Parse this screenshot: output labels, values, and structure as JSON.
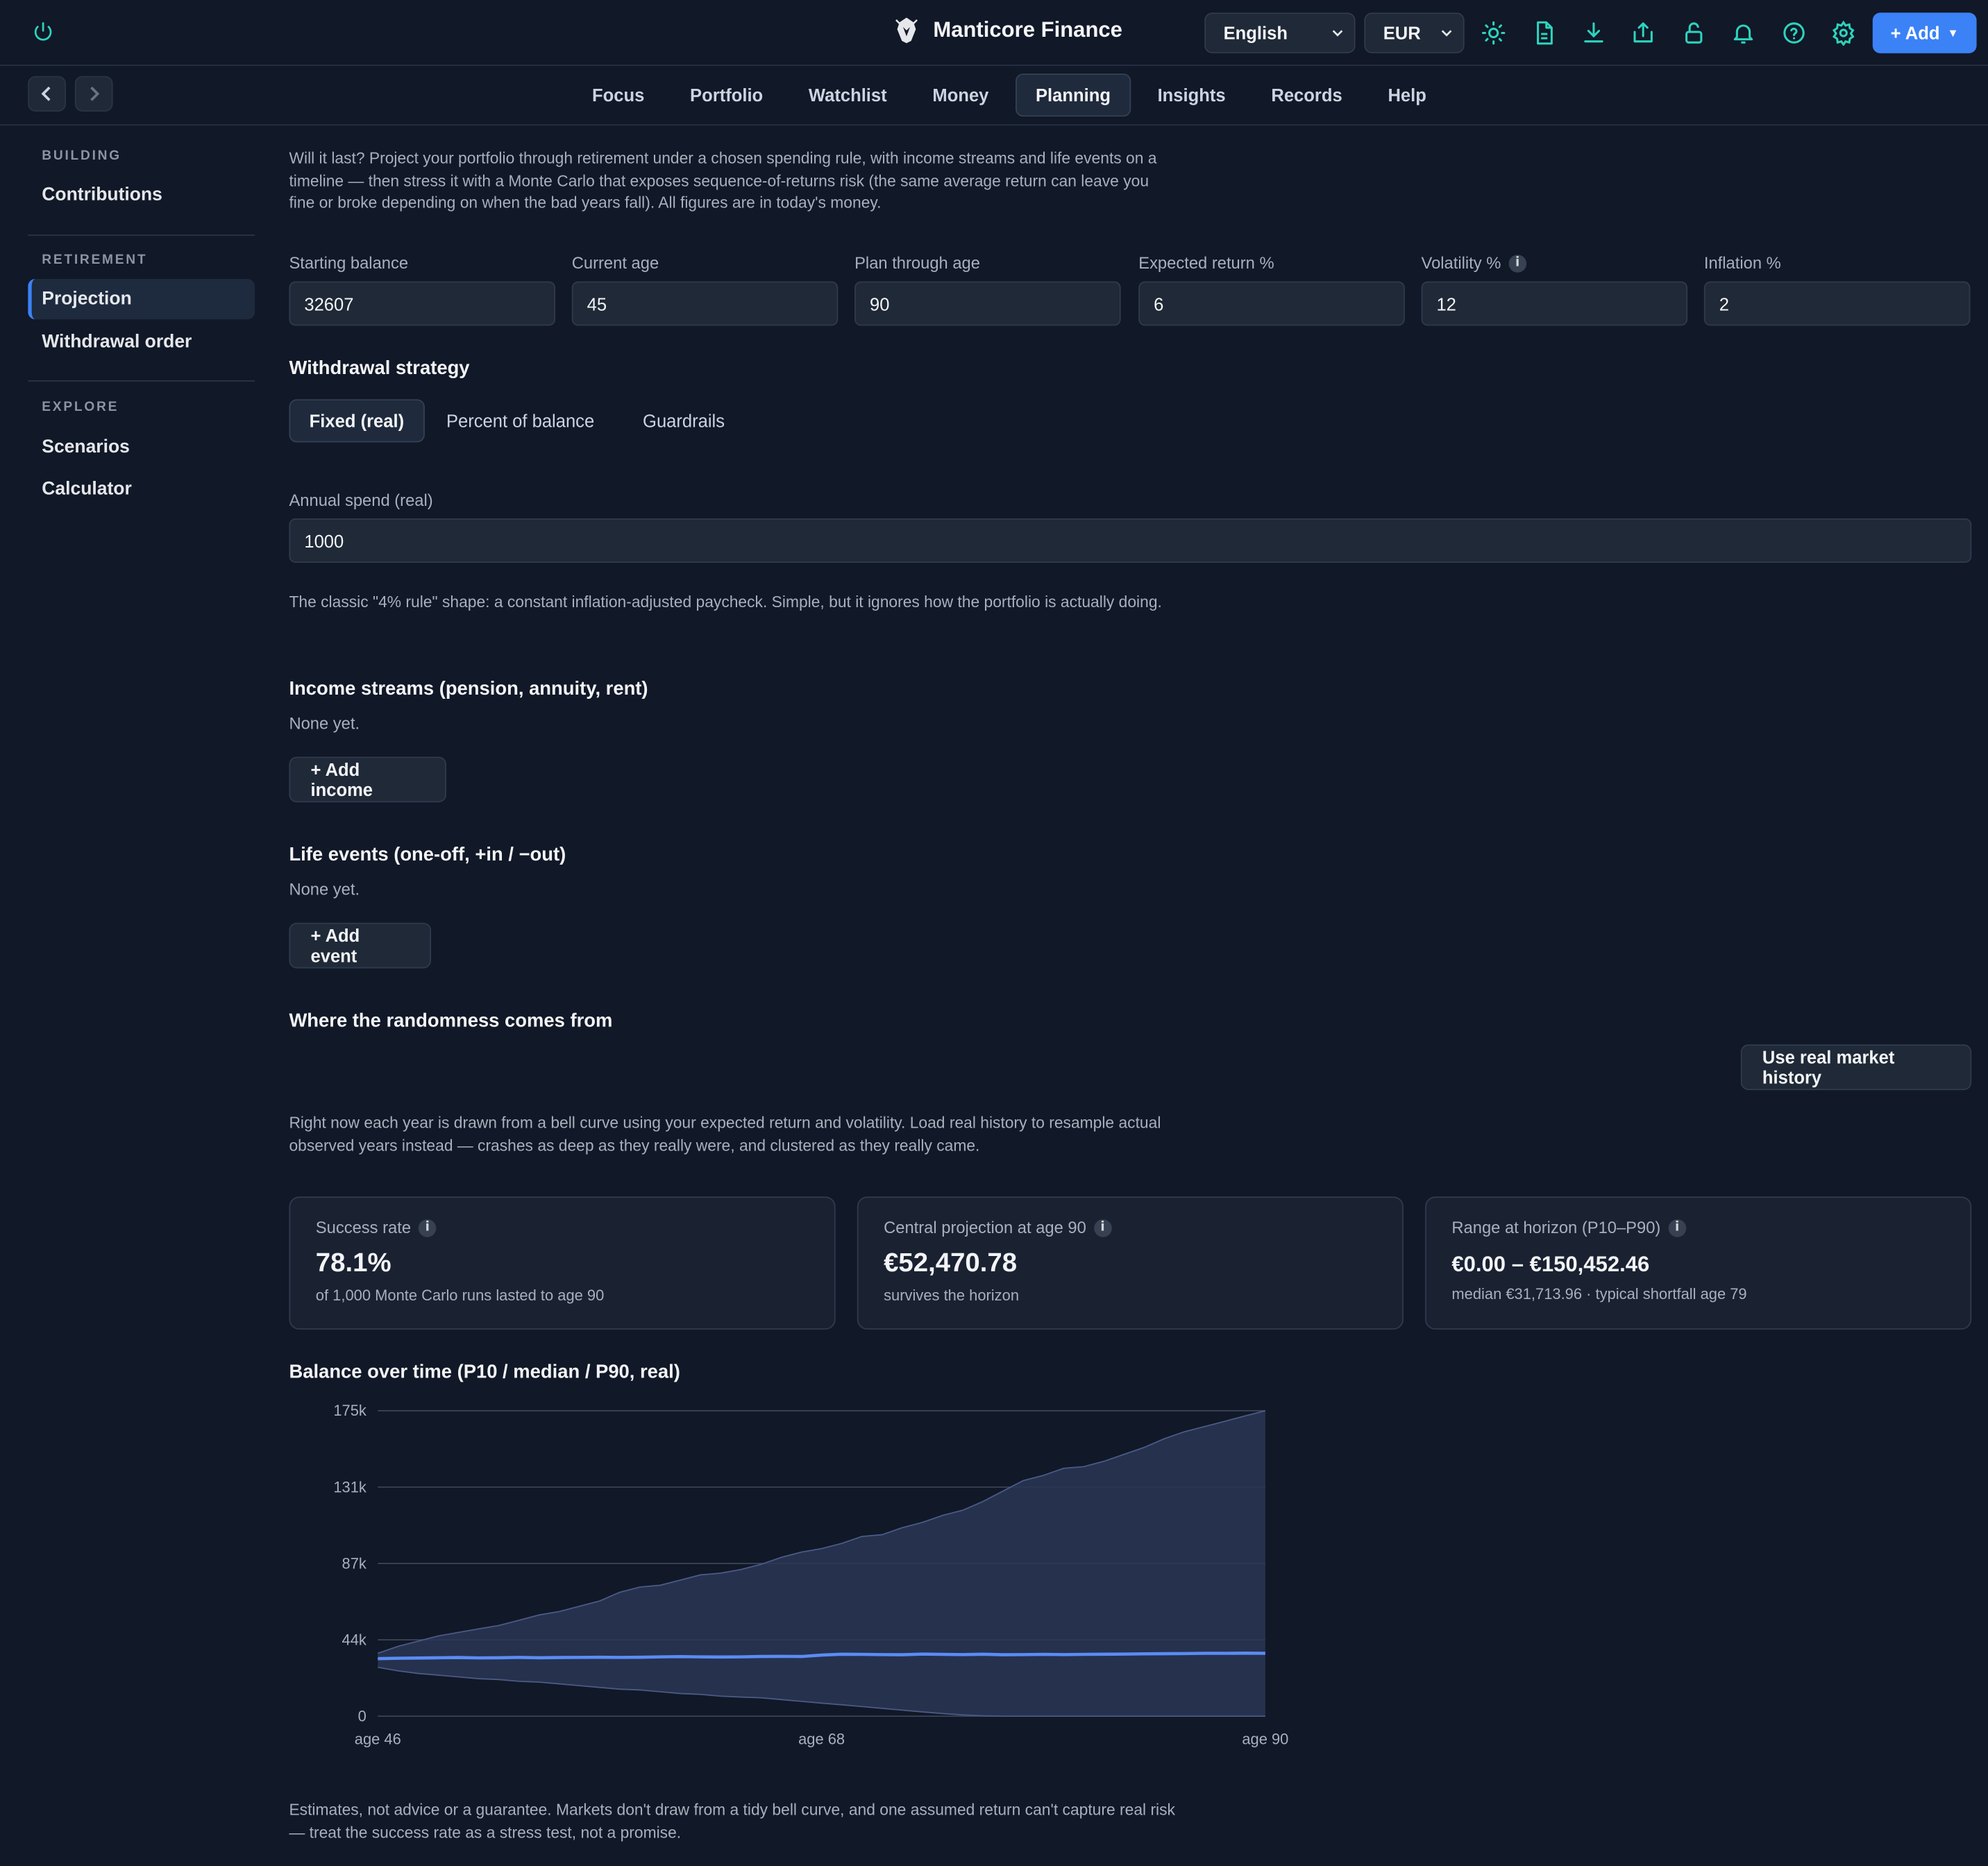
{
  "topbar": {
    "brand": "Manticore Finance",
    "language": "English",
    "currency": "EUR",
    "icons": [
      "power-icon",
      "sun-icon",
      "document-icon",
      "download-icon",
      "share-icon",
      "unlock-icon",
      "bell-icon",
      "help-icon",
      "gear-icon"
    ],
    "add_label": "+ Add",
    "accent_color": "#3b82f6",
    "icon_color": "#2dd4bf"
  },
  "nav": {
    "tabs": [
      "Focus",
      "Portfolio",
      "Watchlist",
      "Money",
      "Planning",
      "Insights",
      "Records",
      "Help"
    ],
    "active_tab": "Planning"
  },
  "sidebar": {
    "groups": [
      {
        "label": "BUILDING",
        "items": [
          "Contributions"
        ]
      },
      {
        "label": "RETIREMENT",
        "items": [
          "Projection",
          "Withdrawal order"
        ]
      },
      {
        "label": "EXPLORE",
        "items": [
          "Scenarios",
          "Calculator"
        ]
      }
    ],
    "active_item": "Projection"
  },
  "main": {
    "intro": "Will it last? Project your portfolio through retirement under a chosen spending rule, with income streams and life events on a timeline — then stress it with a Monte Carlo that exposes sequence-of-returns risk (the same average return can leave you fine or broke depending on when the bad years fall). All figures are in today's money.",
    "fields": [
      {
        "label": "Starting balance",
        "value": "32607"
      },
      {
        "label": "Current age",
        "value": "45"
      },
      {
        "label": "Plan through age",
        "value": "90"
      },
      {
        "label": "Expected return %",
        "value": "6"
      },
      {
        "label": "Volatility %",
        "value": "12"
      },
      {
        "label": "Inflation %",
        "value": "2"
      }
    ],
    "strategy": {
      "heading": "Withdrawal strategy",
      "options": [
        "Fixed (real)",
        "Percent of balance",
        "Guardrails"
      ],
      "selected": "Fixed (real)",
      "spend_label": "Annual spend (real)",
      "spend_value": "1000",
      "note": "The classic \"4% rule\" shape: a constant inflation-adjusted paycheck. Simple, but it ignores how the portfolio is actually doing."
    },
    "income": {
      "heading": "Income streams (pension, annuity, rent)",
      "empty": "None yet.",
      "button": "+ Add income"
    },
    "events": {
      "heading": "Life events (one-off, +in / −out)",
      "empty": "None yet.",
      "button": "+ Add event"
    },
    "randomness": {
      "heading": "Where the randomness comes from",
      "button": "Use real market history",
      "note": "Right now each year is drawn from a bell curve using your expected return and volatility. Load real history to resample actual observed years instead — crashes as deep as they really were, and clustered as they really came."
    },
    "cards": [
      {
        "title": "Success rate",
        "value": "78.1%",
        "sub": "of 1,000 Monte Carlo runs lasted to age 90"
      },
      {
        "title": "Central projection at age 90",
        "value": "€52,470.78",
        "sub": "survives the horizon"
      },
      {
        "title": "Range at horizon (P10–P90)",
        "value": "€0.00 – €150,452.46",
        "sub": "median €31,713.96 · typical shortfall age 79"
      }
    ],
    "disclaimer": "Estimates, not advice or a guarantee. Markets don't draw from a tidy bell curve, and one assumed return can't capture real risk — treat the success rate as a stress test, not a promise."
  },
  "chart_data": {
    "type": "area",
    "title": "Balance over time (P10 / median / P90, real)",
    "x": [
      46,
      47,
      48,
      49,
      50,
      51,
      52,
      53,
      54,
      55,
      56,
      57,
      58,
      59,
      60,
      61,
      62,
      63,
      64,
      65,
      66,
      67,
      68,
      69,
      70,
      71,
      72,
      73,
      74,
      75,
      76,
      77,
      78,
      79,
      80,
      81,
      82,
      83,
      84,
      85,
      86,
      87,
      88,
      89,
      90
    ],
    "x_tick_labels": [
      "age 46",
      "age 68",
      "age 90"
    ],
    "y_tick_labels": [
      "0",
      "44k",
      "87k",
      "131k",
      "175k"
    ],
    "ylim": [
      0,
      175000
    ],
    "series": [
      {
        "name": "P90",
        "values": [
          36000,
          40000,
          43000,
          46000,
          48000,
          50000,
          52000,
          55000,
          58000,
          60000,
          63000,
          66000,
          71000,
          74000,
          75000,
          78000,
          81000,
          82000,
          84000,
          87000,
          91000,
          94000,
          96000,
          99000,
          103000,
          104000,
          108000,
          111000,
          115000,
          118000,
          123000,
          129000,
          135000,
          138000,
          142000,
          143000,
          146000,
          150000,
          154000,
          159000,
          163000,
          166000,
          169000,
          172000,
          175000
        ]
      },
      {
        "name": "median",
        "values": [
          33000,
          33200,
          33300,
          33500,
          33600,
          33400,
          33500,
          33700,
          33500,
          33600,
          33700,
          33800,
          33700,
          33800,
          34000,
          34100,
          34000,
          33900,
          34000,
          34200,
          34300,
          34200,
          35000,
          35500,
          35400,
          35300,
          35200,
          35600,
          35400,
          35300,
          35500,
          35200,
          35300,
          35400,
          35300,
          35400,
          35500,
          35600,
          35700,
          35800,
          35900,
          36000,
          36000,
          36100,
          36000
        ]
      },
      {
        "name": "P10",
        "values": [
          28000,
          26000,
          24500,
          23500,
          22500,
          21500,
          21000,
          20000,
          19500,
          18500,
          17500,
          16500,
          15500,
          15000,
          14000,
          13000,
          12500,
          11500,
          11000,
          10500,
          9500,
          8500,
          7500,
          6500,
          5500,
          4500,
          3500,
          2500,
          1500,
          700,
          200,
          0,
          0,
          0,
          0,
          0,
          0,
          0,
          0,
          0,
          0,
          0,
          0,
          0,
          0
        ]
      }
    ],
    "colors": {
      "band": "#2a3656",
      "median": "#5b8cf5",
      "grid": "#3a4456"
    }
  }
}
